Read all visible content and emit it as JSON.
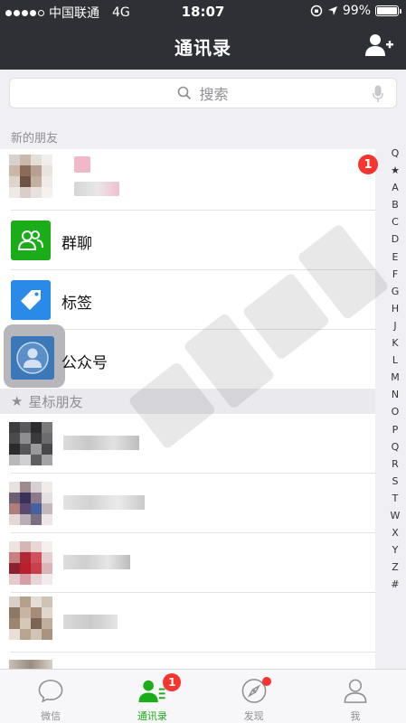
{
  "status": {
    "carrier": "中国联通",
    "network": "4G",
    "time": "18:07",
    "battery": "99%",
    "battery_level": 0.99
  },
  "nav": {
    "title": "通讯录"
  },
  "search": {
    "placeholder": "搜索"
  },
  "sections": {
    "new_friends": "新的朋友",
    "starred": "星标朋友"
  },
  "new_friend": {
    "badge": "1"
  },
  "rows": [
    {
      "label": "群聊"
    },
    {
      "label": "标签"
    },
    {
      "label": "公众号"
    }
  ],
  "index": [
    "Q",
    "★",
    "A",
    "B",
    "C",
    "D",
    "E",
    "F",
    "G",
    "H",
    "J",
    "K",
    "L",
    "M",
    "N",
    "O",
    "P",
    "Q",
    "R",
    "S",
    "T",
    "W",
    "X",
    "Y",
    "Z",
    "#"
  ],
  "tabs": [
    {
      "label": "微信"
    },
    {
      "label": "通讯录",
      "badge": "1"
    },
    {
      "label": "发现"
    },
    {
      "label": "我"
    }
  ],
  "colors": {
    "green": "#1aad19",
    "tag_blue": "#2a8ae8",
    "official_blue": "#3a78b8",
    "badge_red": "#f43530",
    "nav_dark": "#2f3035"
  }
}
